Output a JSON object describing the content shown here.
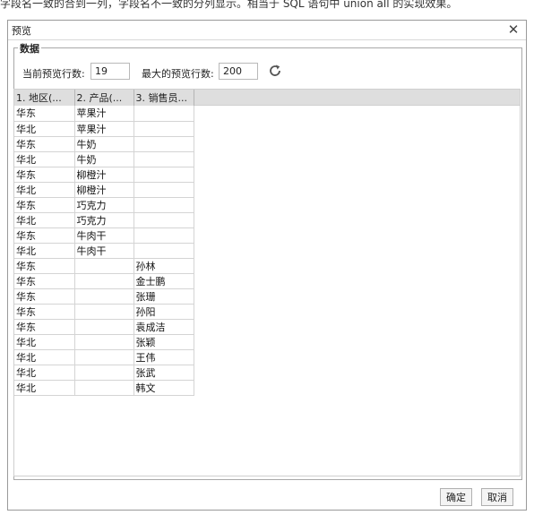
{
  "top_caption": "字段名一致的合到一列，字段名不一致的分列显示。相当于 SQL 语句中 union all 的实现效果。",
  "dialog": {
    "title": "预览",
    "close_symbol": "✕",
    "group_title": "数据",
    "current_rows_label": "当前预览行数:",
    "current_rows_value": "19",
    "max_rows_label": "最大的预览行数:",
    "max_rows_value": "200",
    "ok_label": "确定",
    "cancel_label": "取消"
  },
  "table": {
    "columns": [
      "1. 地区(...",
      "2. 产品(...",
      "3. 销售员..."
    ],
    "rows": [
      [
        "华东",
        "苹果汁",
        ""
      ],
      [
        "华北",
        "苹果汁",
        ""
      ],
      [
        "华东",
        "牛奶",
        ""
      ],
      [
        "华北",
        "牛奶",
        ""
      ],
      [
        "华东",
        "柳橙汁",
        ""
      ],
      [
        "华北",
        "柳橙汁",
        ""
      ],
      [
        "华东",
        "巧克力",
        ""
      ],
      [
        "华北",
        "巧克力",
        ""
      ],
      [
        "华东",
        "牛肉干",
        ""
      ],
      [
        "华北",
        "牛肉干",
        ""
      ],
      [
        "华东",
        "",
        "孙林"
      ],
      [
        "华东",
        "",
        "金士鹏"
      ],
      [
        "华东",
        "",
        "张珊"
      ],
      [
        "华东",
        "",
        "孙阳"
      ],
      [
        "华东",
        "",
        "袁成洁"
      ],
      [
        "华北",
        "",
        "张颖"
      ],
      [
        "华北",
        "",
        "王伟"
      ],
      [
        "华北",
        "",
        "张武"
      ],
      [
        "华北",
        "",
        "韩文"
      ]
    ]
  },
  "icons": {
    "refresh": "refresh-icon",
    "close": "close-icon"
  },
  "colors": {
    "header_bg": "#dedede",
    "border": "#9a9a9a",
    "refresh_icon": "#555555"
  }
}
